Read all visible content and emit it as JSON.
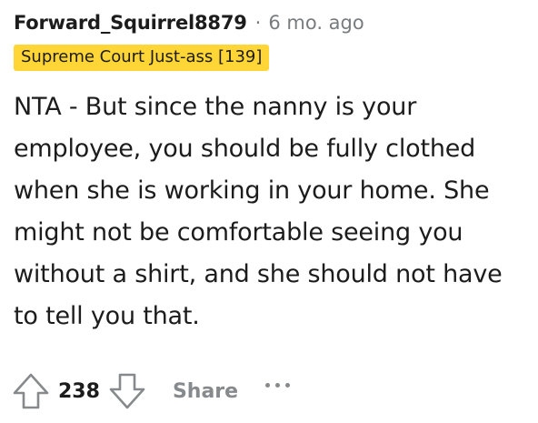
{
  "comment": {
    "author": "Forward_Squirrel8879",
    "separator": "·",
    "age": "6 mo. ago",
    "flair": "Supreme Court Just-ass [139]",
    "flair_color": "#ffd635",
    "body": "NTA - But since the nanny is your employee, you should be fully clothed when she is working in your home. She might not be comfortable seeing you without a shirt, and she should not have to tell you that."
  },
  "actions": {
    "upvote_icon": "arrow-up-icon",
    "score": "238",
    "downvote_icon": "arrow-down-icon",
    "share_label": "Share",
    "more_icon": "more-horizontal-icon"
  }
}
